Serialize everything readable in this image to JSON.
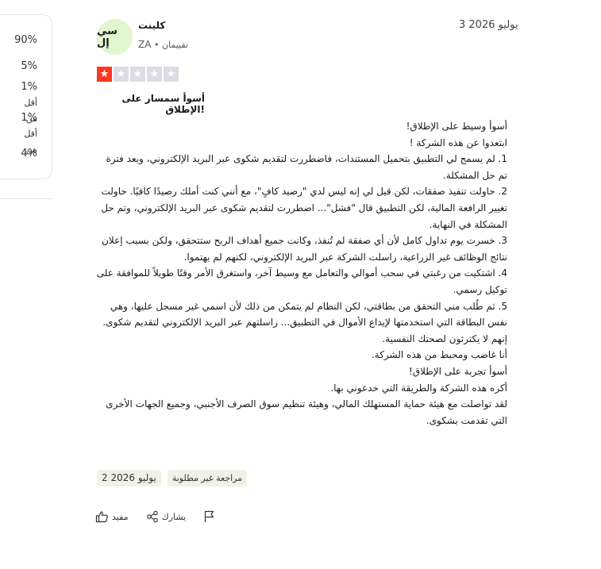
{
  "distribution": {
    "p1": "90%",
    "p2": "5%",
    "p3_value": "1%",
    "p3_line1": "أقل",
    "p3_line2": "من",
    "p4_value": "1%",
    "p4_line1": "أقل",
    "p4_line2": "من",
    "p5": "4%"
  },
  "review": {
    "date": "3 يوليو 2026",
    "reviewer_name": "كلينت",
    "avatar_initials": "سي إل",
    "reviewer_country": "ZA",
    "reviewer_reviews": "تقييمان",
    "star_rating": 1,
    "title": "أسوأ سمسار على الإطلاق!",
    "body": [
      "أسوأ وسيط على الإطلاق!",
      "ابتعدوا عن هذه الشركة !",
      "1. لم يسمح لي التطبيق بتحميل المستندات، فاضطررت لتقديم شكوى عبر البريد الإلكتروني، وبعد فترة تم حل المشكلة.",
      "2. حاولت تنفيذ صفقات، لكن قيل لي إنه ليس لدي \"رصيد كافٍ\"، مع أنني كنت أملك رصيدًا كافيًا. حاولت تغيير الرافعة المالية، لكن التطبيق قال \"فشل\"... اضطررت لتقديم شكوى عبر البريد الإلكتروني، وتم حل المشكلة في النهاية.",
      "3. خسرت يوم تداول كامل لأن أي صفقة لم تُنفذ، وكانت جميع أهداف الربح ستتحقق، ولكن بسبب إعلان نتائج الوظائف غير الزراعية، راسلت الشركة عبر البريد الإلكتروني، لكنهم لم يهتموا.",
      "4. اشتكيت من رغبتي في سحب أموالي والتعامل مع وسيط آخر، واستغرق الأمر وقتًا طويلاً للموافقة على توكيل رسمي.",
      "5. ثم طُلب مني التحقق من بطاقتي، لكن النظام لم يتمكن من ذلك لأن اسمي غير مسجل عليها، وهي نفس البطاقة التي استخدمتها لإيداع الأموال في التطبيق... راسلتهم عبر البريد الإلكتروني لتقديم شكوى.",
      "إنهم لا يكترثون لصحتك النفسية.",
      "أنا غاضب ومحبط من هذه الشركة.",
      "أسوأ تجربة على الإطلاق!",
      "أكره هذه الشركة والطريقة التي خدعوني بها.",
      "لقد تواصلت مع هيئة حماية المستهلك المالي، وهيئة تنظيم سوق الصرف الأجنبي، وجميع الجهات الأخرى التي تقدمت بشكوى."
    ],
    "tags": {
      "experience_date": "2 يوليو 2026",
      "unsolicited": "مراجعة غير مطلوبة"
    },
    "actions": {
      "useful": "مفيد",
      "share": "يشارك"
    }
  },
  "colors": {
    "star_active": "#ff3722",
    "star_inactive": "#dcdce6",
    "avatar_bg": "#e1f7d0",
    "tag_bg": "#f1f1e8"
  },
  "icons": [
    "star-icon",
    "thumbs-up-icon",
    "share-icon",
    "flag-icon"
  ]
}
